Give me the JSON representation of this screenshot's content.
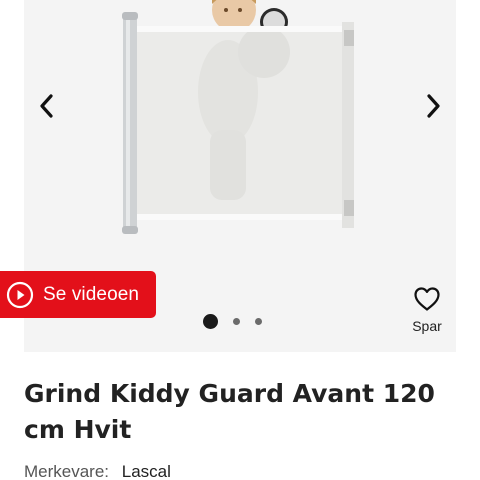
{
  "gallery": {
    "image_alt": "Kiddy Guard Avant safety gate",
    "prev_icon": "chevron-left-icon",
    "next_icon": "chevron-right-icon",
    "slide_count": 3,
    "active_slide": 1
  },
  "video_button": {
    "label": "Se videoen",
    "icon": "play-circle-icon",
    "color": "#e3101a"
  },
  "save": {
    "label": "Spar",
    "icon": "heart-outline-icon"
  },
  "product": {
    "title": "Grind Kiddy Guard Avant 120 cm Hvit",
    "brand_label": "Merkevare:",
    "brand_value": "Lascal"
  }
}
